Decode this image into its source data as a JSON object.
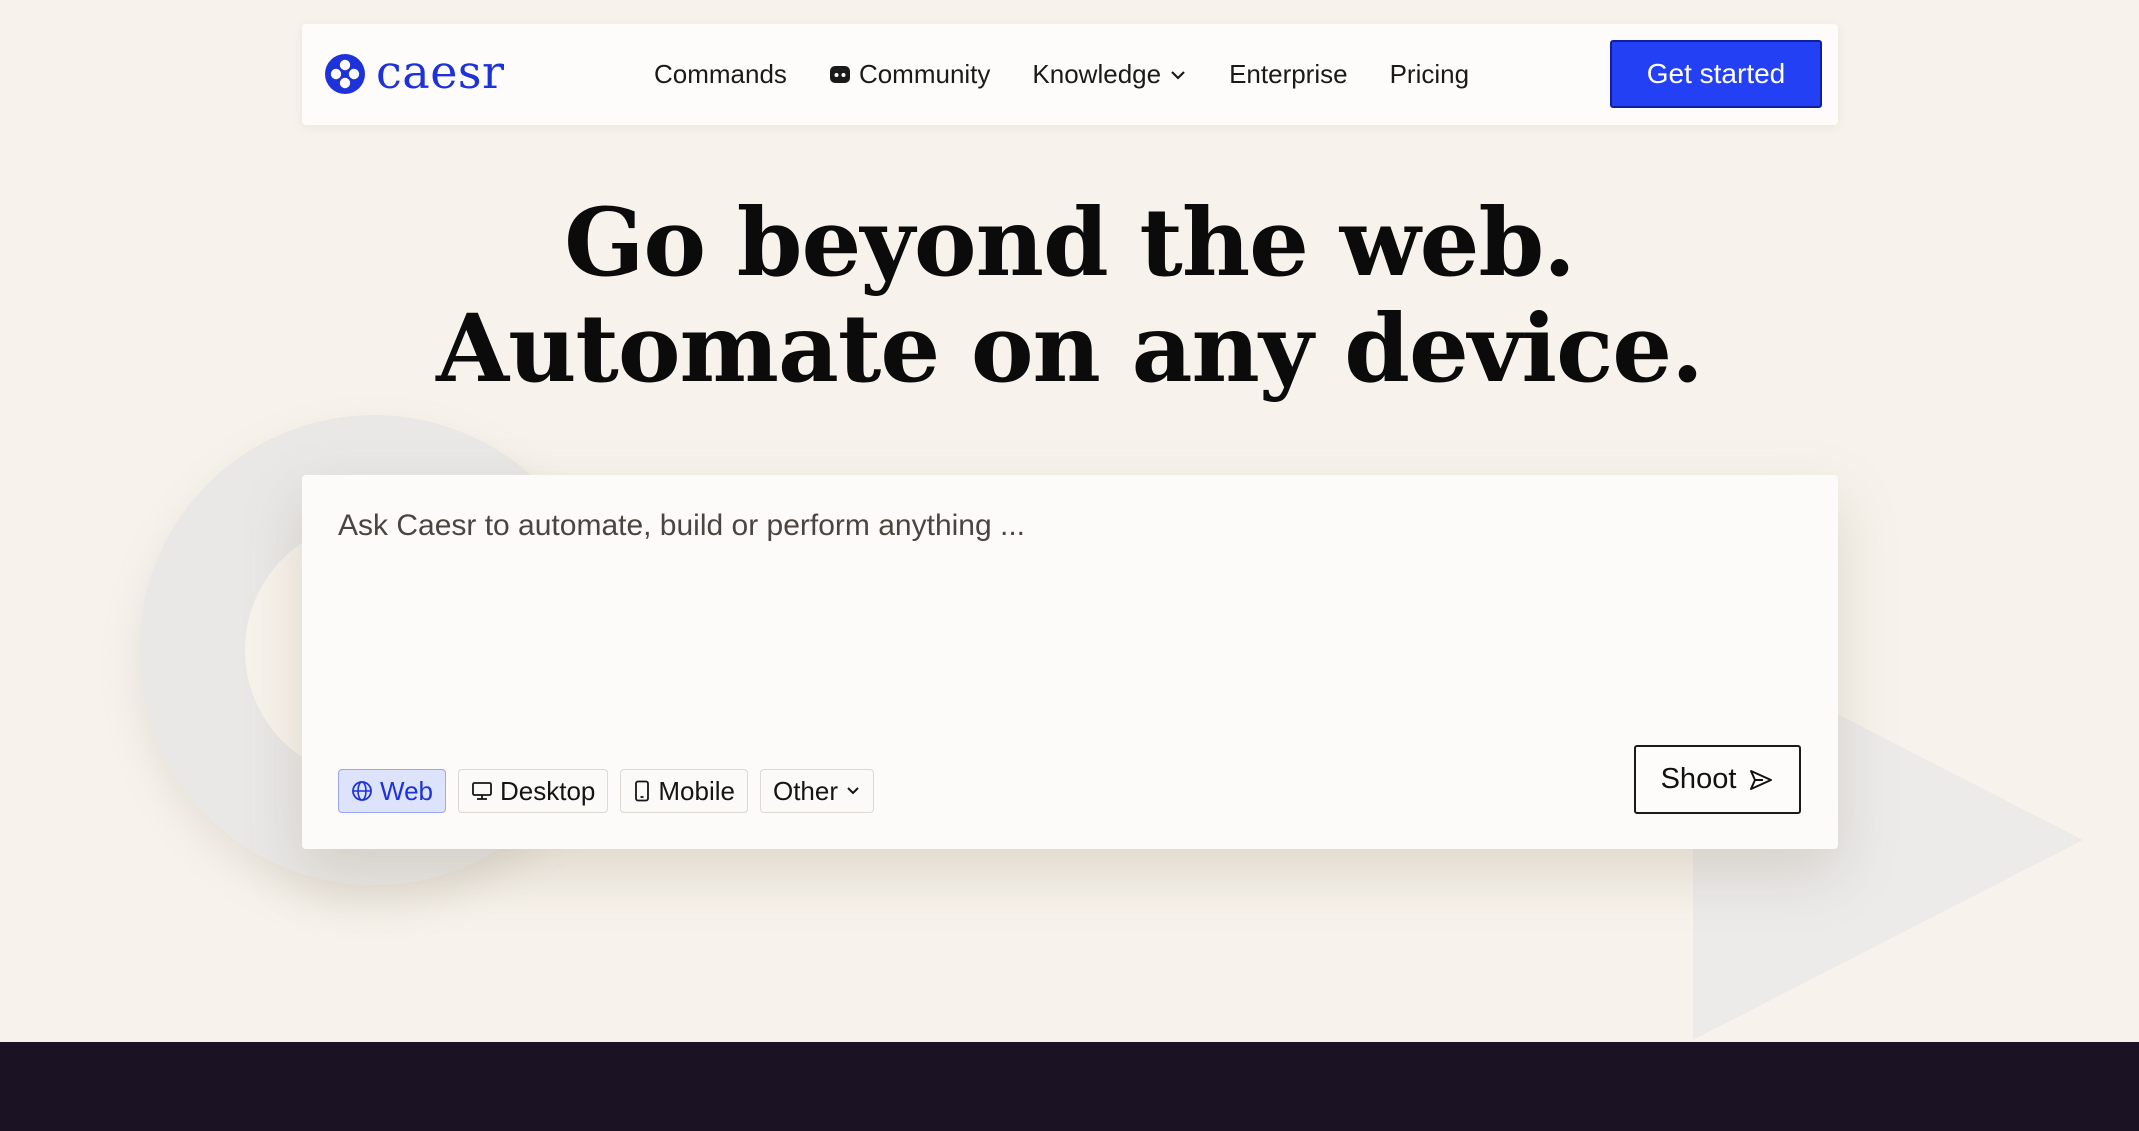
{
  "brand": {
    "name": "caesr",
    "color": "#1d32d8"
  },
  "nav": {
    "links": [
      {
        "label": "Commands"
      },
      {
        "label": "Community",
        "icon": "discord-icon"
      },
      {
        "label": "Knowledge",
        "icon": "chevron-down-icon"
      },
      {
        "label": "Enterprise"
      },
      {
        "label": "Pricing"
      }
    ],
    "cta_label": "Get started",
    "cta_color": "#2440f4"
  },
  "hero": {
    "line1": "Go beyond the web.",
    "line2": "Automate on any device."
  },
  "prompt": {
    "placeholder": "Ask Caesr to automate, build or perform anything ...",
    "value": "",
    "modes": [
      {
        "label": "Web",
        "icon": "globe-icon",
        "selected": true
      },
      {
        "label": "Desktop",
        "icon": "monitor-icon",
        "selected": false
      },
      {
        "label": "Mobile",
        "icon": "phone-icon",
        "selected": false
      },
      {
        "label": "Other",
        "icon": "chevron-down-icon",
        "selected": false
      }
    ],
    "submit_label": "Shoot",
    "submit_icon": "send-icon"
  },
  "colors": {
    "page_bg": "#f7f3ec",
    "footer_bg": "#1b1224",
    "active_chip_bg": "#dde3fb"
  }
}
